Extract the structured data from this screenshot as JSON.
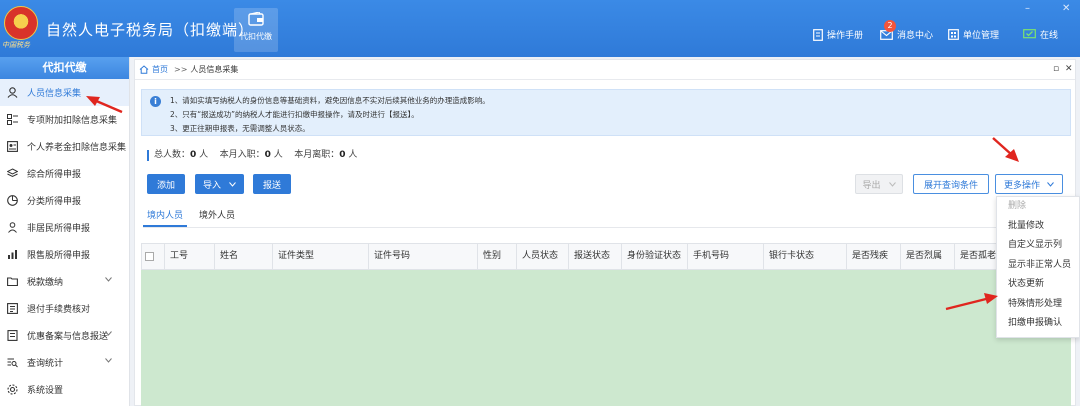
{
  "header": {
    "app_title": "自然人电子税务局（扣缴端）",
    "emblem_text": "中国税务",
    "tool_tile_label": "代扣代缴",
    "nav": [
      {
        "label": "操作手册",
        "icon": "manual-icon"
      },
      {
        "label": "消息中心",
        "icon": "mail-icon",
        "badge": "2"
      },
      {
        "label": "单位管理",
        "icon": "building-icon"
      },
      {
        "label": "在线",
        "icon": "online-check-icon"
      }
    ],
    "window_controls": {
      "minimize": "–",
      "close": "✕"
    }
  },
  "sidebar": {
    "title": "代扣代缴",
    "items": [
      {
        "label": "人员信息采集",
        "icon": "user-icon",
        "active": true
      },
      {
        "label": "专项附加扣除信息采集",
        "icon": "list-icon"
      },
      {
        "label": "个人养老金扣除信息采集",
        "icon": "id-card-icon"
      },
      {
        "label": "综合所得申报",
        "icon": "layers-icon"
      },
      {
        "label": "分类所得申报",
        "icon": "pie-icon"
      },
      {
        "label": "非居民所得申报",
        "icon": "person-icon"
      },
      {
        "label": "限售股所得申报",
        "icon": "bar-chart-icon"
      },
      {
        "label": "税款缴纳",
        "icon": "folder-icon",
        "expandable": true
      },
      {
        "label": "退付手续费核对",
        "icon": "checklist-icon"
      },
      {
        "label": "优惠备案与信息报送",
        "icon": "document-icon",
        "expandable": true
      },
      {
        "label": "查询统计",
        "icon": "search-list-icon",
        "expandable": true
      },
      {
        "label": "系统设置",
        "icon": "gear-icon"
      }
    ]
  },
  "main": {
    "breadcrumb": {
      "home": "首页",
      "separator": ">>",
      "current": "人员信息采集"
    },
    "crumb_controls": {
      "restore": "▫",
      "close": "✕"
    },
    "notice": {
      "icon": "i",
      "lines": [
        "1、请如实填写纳税人的身份信息等基础资料，避免因信息不实对后续其他业务的办理造成影响。",
        "2、只有“报送成功”的纳税人才能进行扣缴申报操作，请及时进行【报送】。",
        "3、更正往期申报表，无需调整人员状态。"
      ]
    },
    "stats": {
      "total_label": "总人数：",
      "total_value": "0",
      "total_unit": " 人",
      "hired_label": "本月入职：",
      "hired_value": "0",
      "hired_unit": " 人",
      "left_label": "本月离职：",
      "left_value": "0",
      "left_unit": " 人"
    },
    "toolbar": {
      "add": "添加",
      "import": "导入",
      "submit": "报送",
      "export": "导出",
      "expand_query": "展开查询条件",
      "more_ops": "更多操作"
    },
    "tabs": [
      "境内人员",
      "境外人员"
    ],
    "table": {
      "columns": [
        "工号",
        "姓名",
        "证件类型",
        "证件号码",
        "性别",
        "人员状态",
        "报送状态",
        "身份验证状态",
        "手机号码",
        "银行卡状态",
        "是否残疾",
        "是否烈属",
        "是否孤老"
      ]
    },
    "more_menu": [
      {
        "label": "删除",
        "disabled": true
      },
      {
        "label": "批量修改"
      },
      {
        "label": "自定义显示列"
      },
      {
        "label": "显示非正常人员"
      },
      {
        "label": "状态更新"
      },
      {
        "label": "特殊情形处理"
      },
      {
        "label": "扣缴申报确认"
      }
    ]
  },
  "colors": {
    "brand_blue": "#2f7ad8",
    "header_blue": "#3b8ae6",
    "table_body_green": "#cde8cf",
    "annotation_red": "#e0261f",
    "badge_red": "#f2553c"
  }
}
